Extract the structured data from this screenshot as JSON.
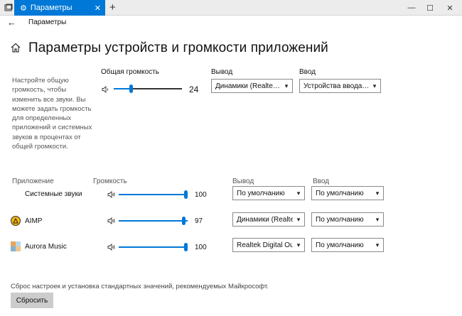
{
  "titlebar": {
    "tab_title": "Параметры",
    "tab_close": "✕",
    "new_tab": "+",
    "minimize": "—",
    "maximize": "☐",
    "close": "✕"
  },
  "nav": {
    "back": "←",
    "title": "Параметры"
  },
  "page": {
    "title": "Параметры устройств и громкости приложений"
  },
  "master": {
    "description": "Настройте общую громкость, чтобы изменить все звуки. Вы можете задать громкость для определенных приложений и системных звуков в процентах от общей громкости.",
    "volume_label": "Общая громкость",
    "volume_value": "24",
    "volume_level": 0.24,
    "output_label": "Вывод",
    "output_value": "Динамики (Realte…",
    "input_label": "Ввод",
    "input_value": "Устройства ввода…"
  },
  "apps": {
    "col_app": "Приложение",
    "col_volume": "Громкость",
    "col_output": "Вывод",
    "col_input": "Ввод",
    "rows": [
      {
        "name": "Системные звуки",
        "volume": "100",
        "level": 1.0,
        "output": "По умолчанию",
        "input": "По умолчанию",
        "icon": "none"
      },
      {
        "name": "AIMP",
        "volume": "97",
        "level": 0.97,
        "output": "Динамики (Realte",
        "input": "По умолчанию",
        "icon": "aimp-icon"
      },
      {
        "name": "Aurora Music",
        "volume": "100",
        "level": 1.0,
        "output": "Realtek Digital Ou",
        "input": "По умолчанию",
        "icon": "aurora-music-icon"
      }
    ]
  },
  "reset": {
    "text": "Сброс настроек и установка стандартных значений, рекомендуемых Майкрософт.",
    "button": "Сбросить"
  },
  "colors": {
    "accent": "#0078d7",
    "aimp_yellow": "#f6b40e"
  }
}
